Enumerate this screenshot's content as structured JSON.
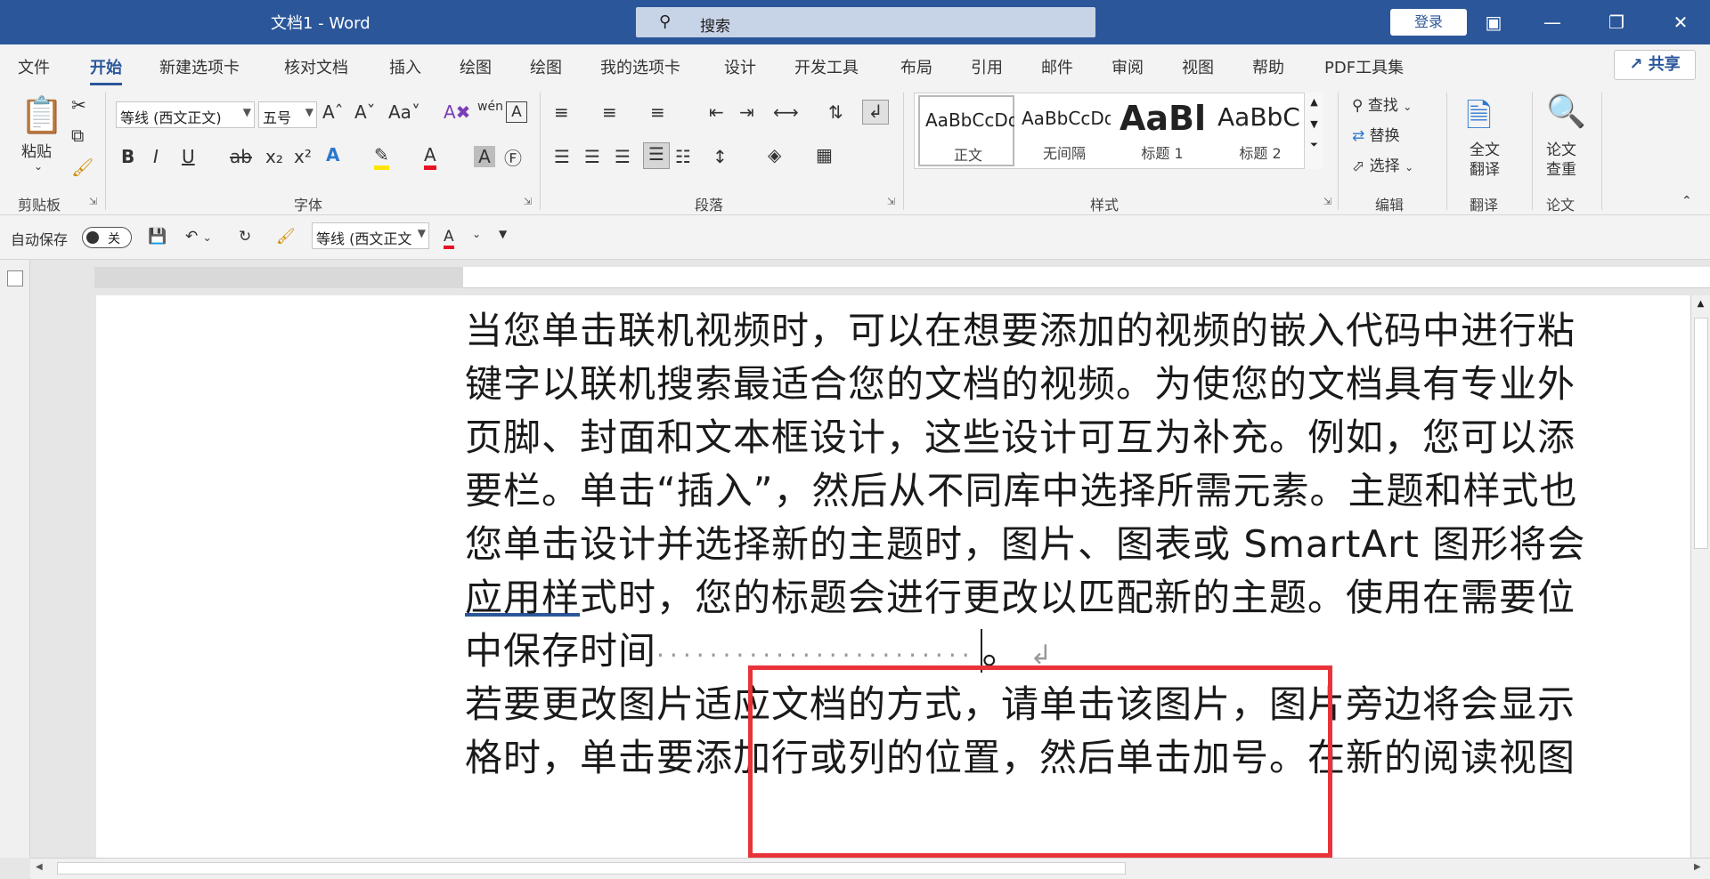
{
  "window": {
    "title": "文档1  -  Word",
    "search_placeholder": "搜索",
    "login_label": "登录"
  },
  "tabs": [
    "文件",
    "开始",
    "新建选项卡",
    "核对文档",
    "插入",
    "绘图",
    "绘图",
    "我的选项卡",
    "设计",
    "开发工具",
    "布局",
    "引用",
    "邮件",
    "审阅",
    "视图",
    "帮助",
    "PDF工具集"
  ],
  "active_tab": "开始",
  "share_label": "共享",
  "ribbon": {
    "clipboard": {
      "paste_label": "粘贴",
      "group_label": "剪贴板"
    },
    "font": {
      "font_name": "等线 (西文正文)",
      "font_size": "五号",
      "group_label": "字体"
    },
    "paragraph": {
      "group_label": "段落"
    },
    "styles": {
      "group_label": "样式",
      "items": [
        {
          "preview": "AaBbCcDd",
          "label": "正文"
        },
        {
          "preview": "AaBbCcDd",
          "label": "无间隔"
        },
        {
          "preview": "AaBl",
          "label": "标题 1"
        },
        {
          "preview": "AaBbC",
          "label": "标题 2"
        }
      ]
    },
    "editing": {
      "find_label": "查找",
      "replace_label": "替换",
      "select_label": "选择",
      "group_label": "编辑"
    },
    "translate": {
      "button_label": "全文\n翻译",
      "line1": "全文",
      "line2": "翻译",
      "group_label": "翻译"
    },
    "paper": {
      "line1": "论文",
      "line2": "查重",
      "group_label": "论文"
    }
  },
  "qat": {
    "autosave_label": "自动保存",
    "toggle_state": "关",
    "font_name": "等线 (西文正文"
  },
  "document": {
    "lines": [
      "当您单击联机视频时，可以在想要添加的视频的嵌入代码中进行粘",
      "键字以联机搜索最适合您的文档的视频。为使您的文档具有专业外",
      "页脚、封面和文本框设计，这些设计可互为补充。例如，您可以添",
      "要栏。单击“插入”，然后从不同库中选择所需元素。主题和样式也",
      "您单击设计并选择新的主题时，图片、图表或 SmartArt 图形将会",
      "式时，您的标题会进行更改以匹配新的主题。使用在需要位",
      "中保存时间",
      "若要更改图片适应文档的方式，请单击该图片，图片旁边将会显示",
      "格时，单击要添加行或列的位置，然后单击加号。在新的阅读视图"
    ],
    "line6_underlined": "应用样",
    "line7_tail": "。",
    "dot_leader": "························"
  },
  "colors": {
    "titlebar": "#2b579a",
    "annotation_box": "#e8333a"
  }
}
